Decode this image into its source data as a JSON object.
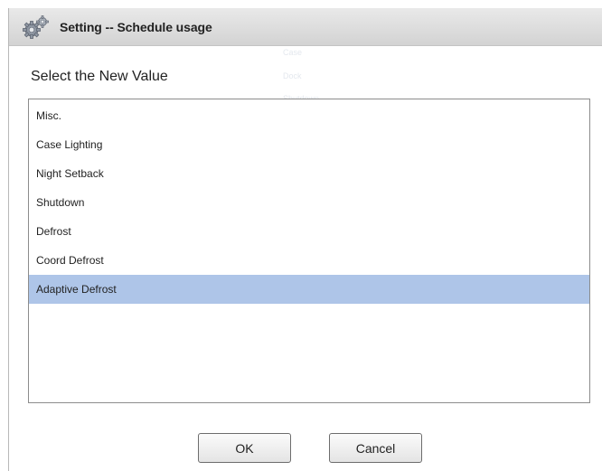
{
  "dialog": {
    "title": "Setting -- Schedule usage",
    "prompt": "Select the New Value",
    "title_icon": "gears-icon"
  },
  "list": {
    "items": [
      {
        "label": "Misc.",
        "selected": false
      },
      {
        "label": "Case Lighting",
        "selected": false
      },
      {
        "label": "Night Setback",
        "selected": false
      },
      {
        "label": "Shutdown",
        "selected": false
      },
      {
        "label": "Defrost",
        "selected": false
      },
      {
        "label": "Coord Defrost",
        "selected": false
      },
      {
        "label": "Adaptive Defrost",
        "selected": true
      }
    ],
    "selected_color": "#aec5e8"
  },
  "buttons": {
    "ok_label": "OK",
    "cancel_label": "Cancel"
  },
  "background_ghost": [
    "Case",
    "Dock",
    "Shutdown"
  ]
}
